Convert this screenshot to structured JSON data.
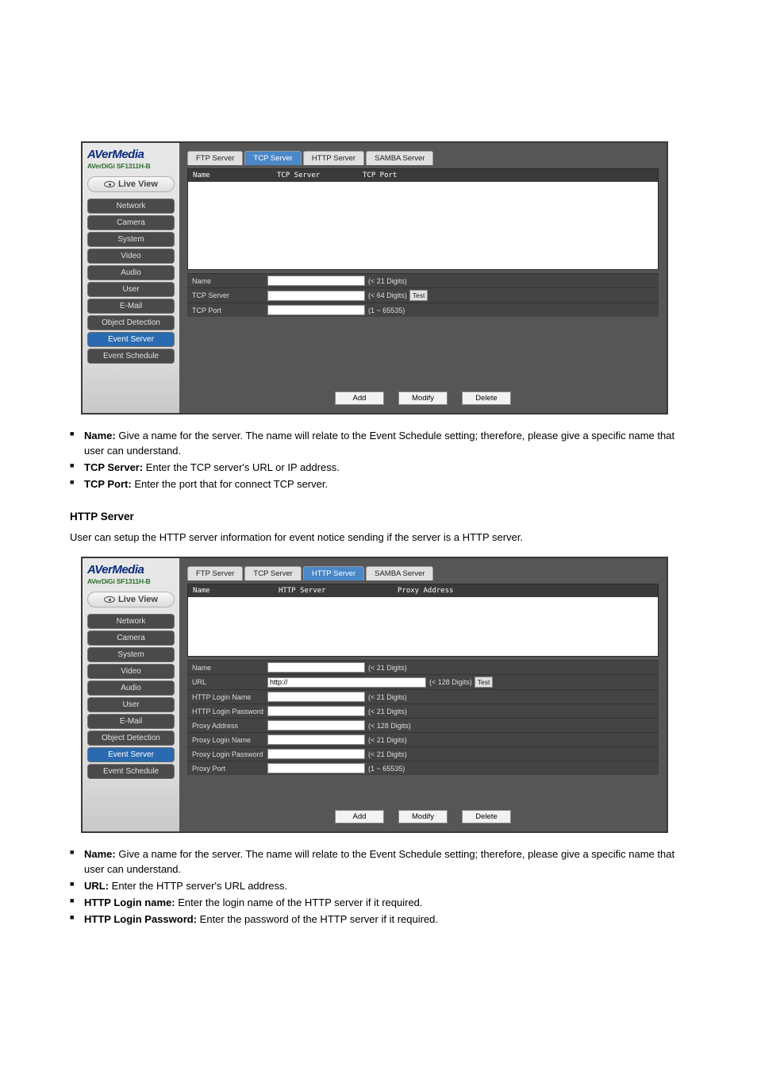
{
  "top": {
    "sidebar": {
      "brand": "AVerMedia",
      "subbrand": "AVerDiGi SF1311H-B",
      "liveview": "Live View",
      "items": [
        "Network",
        "Camera",
        "System",
        "Video",
        "Audio",
        "User",
        "E-Mail",
        "Object Detection",
        "Event Server",
        "Event Schedule"
      ],
      "active_index": 8
    },
    "tabs": [
      "FTP Server",
      "TCP Server",
      "HTTP Server",
      "SAMBA Server"
    ],
    "active_tab": 1,
    "list_head": [
      "Name",
      "TCP Server",
      "TCP Port"
    ],
    "form": {
      "r0": {
        "label": "Name",
        "value": "",
        "hint": "(< 21 Digits)"
      },
      "r1": {
        "label": "TCP Server",
        "value": "",
        "hint": "(< 64 Digits)",
        "test": "Test"
      },
      "r2": {
        "label": "TCP Port",
        "value": "",
        "hint": "(1 ~ 65535)"
      }
    },
    "buttons": [
      "Add",
      "Modify",
      "Delete"
    ]
  },
  "bottom": {
    "sidebar": {
      "brand": "AVerMedia",
      "subbrand": "AVerDiGi SF1311H-B",
      "liveview": "Live View",
      "items": [
        "Network",
        "Camera",
        "System",
        "Video",
        "Audio",
        "User",
        "E-Mail",
        "Object Detection",
        "Event Server",
        "Event Schedule"
      ],
      "active_index": 8
    },
    "tabs": [
      "FTP Server",
      "TCP Server",
      "HTTP Server",
      "SAMBA Server"
    ],
    "active_tab": 2,
    "list_head": [
      "Name",
      "HTTP Server",
      "Proxy Address"
    ],
    "form": {
      "r0": {
        "label": "Name",
        "value": "",
        "hint": "(< 21 Digits)"
      },
      "r1": {
        "label": "URL",
        "value": "http://",
        "hint": "(< 128 Digits)",
        "test": "Test",
        "wide": true
      },
      "r2": {
        "label": "HTTP Login Name",
        "value": "",
        "hint": "(< 21 Digits)"
      },
      "r3": {
        "label": "HTTP Login Password",
        "value": "",
        "hint": "(< 21 Digits)"
      },
      "r4": {
        "label": "Proxy Address",
        "value": "",
        "hint": "(< 128 Digits)"
      },
      "r5": {
        "label": "Proxy Login Name",
        "value": "",
        "hint": "(< 21 Digits)"
      },
      "r6": {
        "label": "Proxy Login Password",
        "value": "",
        "hint": "(< 21 Digits)"
      },
      "r7": {
        "label": "Proxy Port",
        "value": "",
        "hint": "(1 ~ 65535)"
      }
    },
    "buttons": [
      "Add",
      "Modify",
      "Delete"
    ]
  },
  "doc_top": {
    "items": [
      {
        "bold": "Name:",
        "text": " Give a name for the server. The name will relate to the Event Schedule setting; therefore, please give a specific name that user can understand."
      },
      {
        "bold": "TCP Server:",
        "text": " Enter the TCP server's URL or IP address."
      },
      {
        "bold": "TCP Port:",
        "text": " Enter the port that for connect TCP server."
      }
    ],
    "section_title": "HTTP Server",
    "section_sub": "User can setup the HTTP server information for event notice sending if the server is a HTTP server."
  },
  "doc_bottom": {
    "items": [
      {
        "bold": "Name:",
        "text": " Give a name for the server. The name will relate to the Event Schedule setting; therefore, please give a specific name that user can understand."
      },
      {
        "bold": "URL:",
        "text": " Enter the HTTP server's URL address."
      },
      {
        "bold": "HTTP Login name:",
        "text": " Enter the login name of the HTTP server if it required."
      },
      {
        "bold": "HTTP Login Password:",
        "text": " Enter the password of the HTTP server if it required."
      }
    ]
  }
}
